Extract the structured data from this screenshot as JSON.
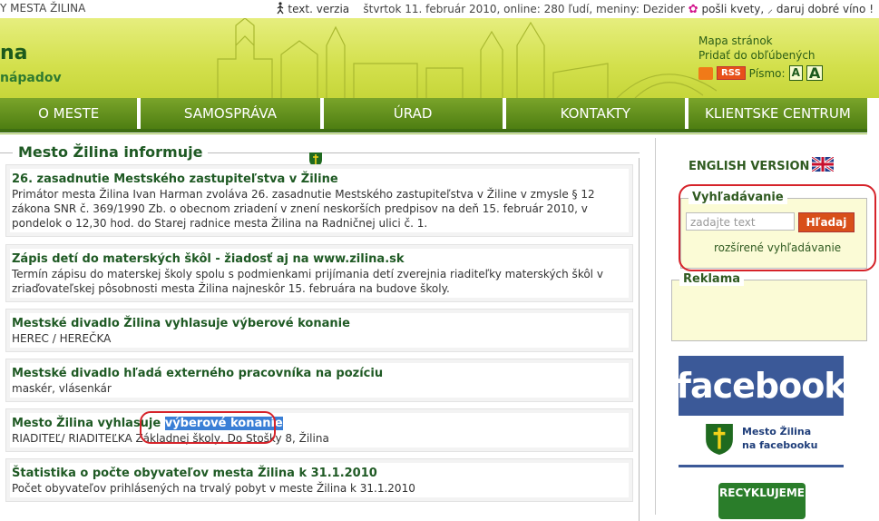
{
  "topbar": {
    "site_name": "Y MESTA ŽILINA",
    "text_version": "text. verzia",
    "info": "štvrtok 11. február 2010, online: 280 ľudí, meniny: Dezider",
    "send_flowers": "pošli kvety,",
    "donate": "daruj dobré víno !"
  },
  "header": {
    "logo_main": "na",
    "logo_sub": "nápadov",
    "sitemap": "Mapa stránok",
    "favorites": "Pridať do obľúbených",
    "rss": "RSS",
    "font_label": "Písmo:",
    "font_small": "A",
    "font_large": "A"
  },
  "nav": {
    "tabs": [
      "O MESTE",
      "SAMOSPRÁVA",
      "ÚRAD",
      "KONTAKTY",
      "KLIENTSKE CENTRUM"
    ]
  },
  "main": {
    "section_title": "Mesto Žilina informuje",
    "items": [
      {
        "title": "26. zasadnutie Mestského zastupiteľstva v Žiline",
        "desc": "Primátor mesta Žilina Ivan Harman zvoláva 26. zasadnutie Mestského zastupiteľstva v Žiline v zmysle § 12 zákona SNR č. 369/1990 Zb. o obecnom zriadení v znení neskorších predpisov na deň 15. február 2010, v pondelok o 12,30 hod. do Starej radnice mesta Žilina na Radničnej ulici č. 1."
      },
      {
        "title": "Zápis detí do materských škôl - žiadosť aj na www.zilina.sk",
        "desc": "Termín zápisu do materskej školy spolu s podmienkami prijímania detí zverejnia riaditeľky materských škôl v zriaďovateľskej pôsobnosti mesta Žilina najneskôr 15. februára na budove školy."
      },
      {
        "title": "Mestské divadlo Žilina vyhlasuje výberové konanie",
        "desc": "HEREC / HEREČKA"
      },
      {
        "title": "Mestské divadlo hľadá externého pracovníka na pozíciu",
        "desc": "maskér, vlásenkár"
      },
      {
        "title_prefix": "Mesto Žilina vyhlasuje ",
        "title_highlight": "výberové konanie",
        "desc": "RIADITEĽ/ RIADITEĽKA Základnej školy, Do Stošky 8, Žilina"
      },
      {
        "title": "Štatistika o počte obyvateľov mesta Žilina k 31.1.2010",
        "desc": "Počet obyvateľov prihlásených na trvalý pobyt v meste Žilina k 31.1.2010"
      }
    ]
  },
  "sidebar": {
    "english": "ENGLISH VERSION",
    "search_title": "Vyhľadávanie",
    "search_placeholder": "zadajte text",
    "search_button": "Hľadaj",
    "advanced": "rozšírené vyhľadávanie",
    "ad_title": "Reklama",
    "facebook": "facebook",
    "fb_line1": "Mesto Žilina",
    "fb_line2": "na facebooku",
    "recycle": "RECYKLUJEME"
  },
  "colors": {
    "green_dark": "#1f5a24",
    "nav_green": "#5c8c1a",
    "header_yellow": "#d3e04c",
    "search_orange": "#d84f1a",
    "facebook_blue": "#3b5998",
    "highlight_blue": "#3a7fd6",
    "annotation_red": "#d6232a"
  }
}
